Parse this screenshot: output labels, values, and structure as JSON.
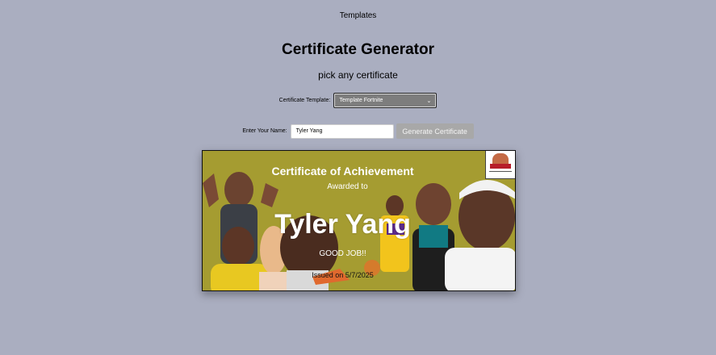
{
  "nav": {
    "templates_link": "Templates"
  },
  "page": {
    "title": "Certificate Generator",
    "subtitle": "pick any certificate"
  },
  "form": {
    "template_label": "Certificate Template:",
    "template_selected": "Template Fortnite",
    "name_label": "Enter Your Name:",
    "name_value": "Tyler Yang",
    "generate_label": "Generate Certificate"
  },
  "certificate": {
    "heading": "Certificate of Achievement",
    "awarded_to": "Awarded to",
    "recipient": "Tyler Yang",
    "message": "GOOD JOB!!",
    "issued": "Issued on 5/7/2025",
    "background_color": "#a59c31"
  }
}
